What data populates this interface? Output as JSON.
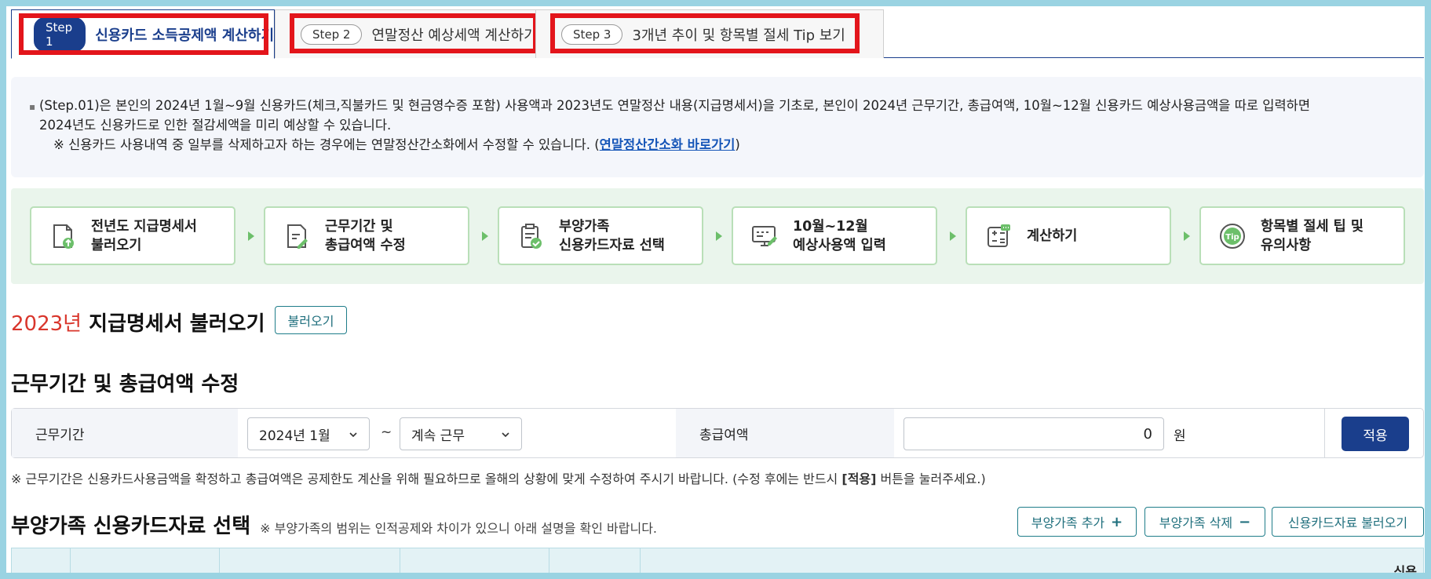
{
  "tabs": [
    {
      "step": "Step 1",
      "label": "신용카드 소득공제액 계산하기",
      "active": true
    },
    {
      "step": "Step 2",
      "label": "연말정산 예상세액 계산하기",
      "active": false
    },
    {
      "step": "Step 3",
      "label": "3개년 추이 및 항목별 절세 Tip 보기",
      "active": false
    }
  ],
  "notice": {
    "line1": "(Step.01)은 본인의 2024년 1월~9월 신용카드(체크,직불카드 및 현금영수증 포함) 사용액과 2023년도 연말정산 내용(지급명세서)을 기초로, 본인이 2024년 근무기간, 총급여액, 10월~12월 신용카드 예상사용금액을 따로 입력하면",
    "line2": "2024년도 신용카드로 인한 절감세액을 미리 예상할 수 있습니다.",
    "line3_prefix": "※ 신용카드 사용내역 중 일부를 삭제하고자 하는 경우에는 연말정산간소화에서 수정할 수 있습니다. (",
    "link": "연말정산간소화 바로가기",
    "line3_suffix": ")"
  },
  "process_steps": [
    {
      "label": "전년도 지급명세서\n불러오기",
      "icon": "document-upload-icon"
    },
    {
      "label": "근무기간 및\n총급여액 수정",
      "icon": "document-edit-icon"
    },
    {
      "label": "부양가족\n신용카드자료 선택",
      "icon": "document-check-icon"
    },
    {
      "label": "10월~12월\n예상사용액 입력",
      "icon": "monitor-edit-icon"
    },
    {
      "label": "계산하기",
      "icon": "calculator-icon"
    },
    {
      "label": "항목별 절세 팁 및\n유의사항",
      "icon": "tip-icon"
    }
  ],
  "statement": {
    "year": "2023년",
    "title": "지급명세서 불러오기",
    "button": "불러오기"
  },
  "work_section": {
    "title": "근무기간 및 총급여액 수정",
    "period_label": "근무기간",
    "start_value": "2024년 1월",
    "tilde": "~",
    "end_value": "계속 근무",
    "salary_label": "총급여액",
    "salary_value": "0",
    "unit": "원",
    "apply_button": "적용",
    "note_prefix": "※ 근무기간은 신용카드사용금액을 확정하고 총급여액은 공제한도 계산을 위해 필요하므로 올해의 상황에 맞게 수정하여 주시기 바랍니다. (수정 후에는 반드시 ",
    "note_bold": "[적용]",
    "note_suffix": " 버튼을 눌러주세요.)"
  },
  "dependents": {
    "title": "부양가족 신용카드자료 선택",
    "note": "※ 부양가족의 범위는 인적공제와 차이가 있으니 아래 설명을 확인 바랍니다.",
    "add_button": "부양가족 추가",
    "add_symbol": "+",
    "delete_button": "부양가족 삭제",
    "delete_symbol": "−",
    "load_button": "신용카드자료 불러오기",
    "table_partial_header": "신용"
  },
  "colors": {
    "primary": "#1a3e8c",
    "highlight_red": "#e3151b",
    "green_bg": "#eaf5ec",
    "teal": "#1f7d8a",
    "year_red": "#d9362c"
  }
}
